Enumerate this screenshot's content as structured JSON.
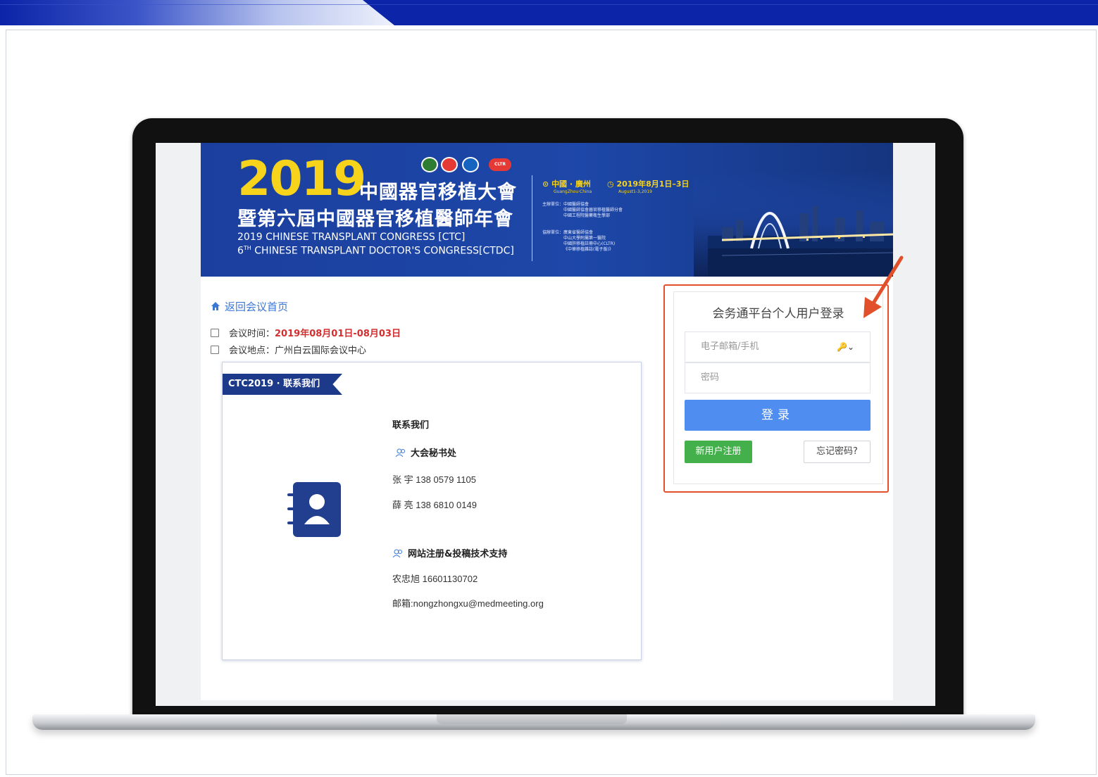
{
  "banner": {
    "year": "2019",
    "cn_title_1": "中國器官移植大會",
    "cn_title_2": "暨第六屆中國器官移植醫師年會",
    "en_title_1": "2019 CHINESE TRANSPLANT CONGRESS [CTC]",
    "en_title_2_prefix": "6",
    "en_title_2_sup": "TH",
    "en_title_2_rest": " CHINESE TRANSPLANT DOCTOR'S CONGRESS[CTDC]",
    "location": "中國 · 廣州",
    "location_en": "GuangZhou·China",
    "dates": "2019年8月1日–3日",
    "dates_en": "August1-3,2019",
    "organizer_lines": [
      "主辦單位：中國醫師協會",
      "中國醫師協會器官移植醫師分會",
      "中國工程院醫藥衛生學部"
    ],
    "co_organizer_lines": [
      "協辦單位：廣東省醫師協會",
      "中山大學附屬第一醫院",
      "中國肝移植註冊中心(CLTR)",
      "《中華移植雜誌(電子版)》"
    ],
    "logo_badge": "CLTR"
  },
  "nav": {
    "back_label": "返回会议首页"
  },
  "meeting": {
    "time_label": "会议时间：",
    "time_value": "2019年08月01日-08月03日",
    "place_label": "会议地点：",
    "place_value": "广州白云国际会议中心"
  },
  "contact": {
    "ribbon": "CTC2019 · 联系我们",
    "title": "联系我们",
    "secretariat_label": "大会秘书处",
    "person_1": "张 宇 138 0579 1105",
    "person_2": "薛 亮 138 6810 0149",
    "support_label": "网站注册&投稿技术支持",
    "support_person": "农忠旭 16601130702",
    "support_email": "邮箱:nongzhongxu@medmeeting.org"
  },
  "login": {
    "title": "会务通平台个人用户登录",
    "account_placeholder": "电子邮箱/手机",
    "key_glyph": "🔑⌄",
    "password_placeholder": "密码",
    "login_label": "登录",
    "register_label": "新用户注册",
    "forgot_label": "忘记密码?"
  },
  "colors": {
    "slide_band": "#0b24a8",
    "banner_blue": "#1d47a8",
    "accent_yellow": "#f7d31c",
    "annotation_red": "#e2502b",
    "login_blue": "#4f8ef0",
    "register_green": "#44b04b",
    "date_red": "#d32f2f"
  }
}
